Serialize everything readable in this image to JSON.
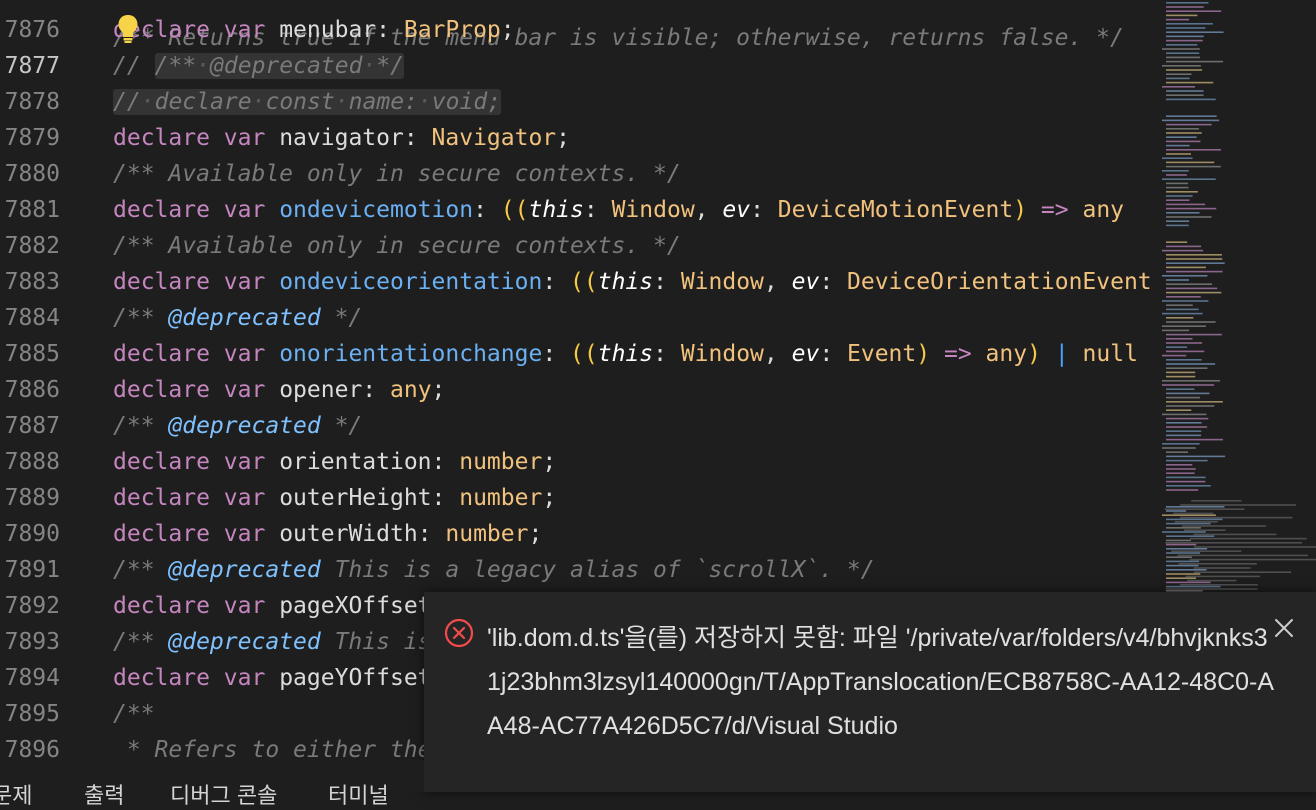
{
  "editor": {
    "top_fragment": "/** Returns true if the menu bar is visible; otherwise, returns false. */",
    "lines": [
      {
        "num": "7876",
        "tokens": [
          [
            "kw",
            "declare"
          ],
          [
            "sp",
            " "
          ],
          [
            "kw",
            "var"
          ],
          [
            "sp",
            " "
          ],
          [
            "id",
            "menubar"
          ],
          [
            "punc",
            ": "
          ],
          [
            "type",
            "BarProp"
          ],
          [
            "punc",
            ";"
          ]
        ]
      },
      {
        "num": "7877",
        "active": true,
        "tokens": [
          [
            "comment",
            "// "
          ],
          [
            "commentHL",
            "/**·@deprecated·*/"
          ]
        ]
      },
      {
        "num": "7878",
        "tokens": [
          [
            "commentHL",
            "//·declare·const·name:·void;"
          ]
        ]
      },
      {
        "num": "7879",
        "tokens": [
          [
            "kw",
            "declare"
          ],
          [
            "sp",
            " "
          ],
          [
            "kw",
            "var"
          ],
          [
            "sp",
            " "
          ],
          [
            "id",
            "navigator"
          ],
          [
            "punc",
            ": "
          ],
          [
            "type",
            "Navigator"
          ],
          [
            "punc",
            ";"
          ]
        ]
      },
      {
        "num": "7880",
        "tokens": [
          [
            "comment",
            "/** Available only in secure contexts. */"
          ]
        ]
      },
      {
        "num": "7881",
        "tokens": [
          [
            "kw",
            "declare"
          ],
          [
            "sp",
            " "
          ],
          [
            "kw",
            "var"
          ],
          [
            "sp",
            " "
          ],
          [
            "prop",
            "ondevicemotion"
          ],
          [
            "punc",
            ": "
          ],
          [
            "paren",
            "(("
          ],
          [
            "this",
            "this"
          ],
          [
            "punc",
            ": "
          ],
          [
            "type",
            "Window"
          ],
          [
            "punc",
            ", "
          ],
          [
            "this",
            "ev"
          ],
          [
            "punc",
            ": "
          ],
          [
            "type",
            "DeviceMotionEvent"
          ],
          [
            "paren",
            ")"
          ],
          [
            "sp",
            " "
          ],
          [
            "arrow",
            "=>"
          ],
          [
            "sp",
            " "
          ],
          [
            "type",
            "any"
          ]
        ]
      },
      {
        "num": "7882",
        "tokens": [
          [
            "comment",
            "/** Available only in secure contexts. */"
          ]
        ]
      },
      {
        "num": "7883",
        "tokens": [
          [
            "kw",
            "declare"
          ],
          [
            "sp",
            " "
          ],
          [
            "kw",
            "var"
          ],
          [
            "sp",
            " "
          ],
          [
            "prop",
            "ondeviceorientation"
          ],
          [
            "punc",
            ": "
          ],
          [
            "paren",
            "(("
          ],
          [
            "this",
            "this"
          ],
          [
            "punc",
            ": "
          ],
          [
            "type",
            "Window"
          ],
          [
            "punc",
            ", "
          ],
          [
            "this",
            "ev"
          ],
          [
            "punc",
            ": "
          ],
          [
            "type",
            "DeviceOrientationEvent"
          ]
        ]
      },
      {
        "num": "7884",
        "tokens": [
          [
            "comment",
            "/** "
          ],
          [
            "tag",
            "@deprecated"
          ],
          [
            "comment",
            " */"
          ]
        ]
      },
      {
        "num": "7885",
        "tokens": [
          [
            "kw",
            "declare"
          ],
          [
            "sp",
            " "
          ],
          [
            "kw",
            "var"
          ],
          [
            "sp",
            " "
          ],
          [
            "prop",
            "onorientationchange"
          ],
          [
            "punc",
            ": "
          ],
          [
            "paren",
            "(("
          ],
          [
            "this",
            "this"
          ],
          [
            "punc",
            ": "
          ],
          [
            "type",
            "Window"
          ],
          [
            "punc",
            ", "
          ],
          [
            "this",
            "ev"
          ],
          [
            "punc",
            ": "
          ],
          [
            "type",
            "Event"
          ],
          [
            "paren",
            ")"
          ],
          [
            "sp",
            " "
          ],
          [
            "arrow",
            "=>"
          ],
          [
            "sp",
            " "
          ],
          [
            "type",
            "any"
          ],
          [
            "paren",
            ")"
          ],
          [
            "sp",
            " "
          ],
          [
            "bar",
            "|"
          ],
          [
            "sp",
            " "
          ],
          [
            "type",
            "null"
          ]
        ]
      },
      {
        "num": "7886",
        "tokens": [
          [
            "kw",
            "declare"
          ],
          [
            "sp",
            " "
          ],
          [
            "kw",
            "var"
          ],
          [
            "sp",
            " "
          ],
          [
            "id",
            "opener"
          ],
          [
            "punc",
            ": "
          ],
          [
            "type",
            "any"
          ],
          [
            "punc",
            ";"
          ]
        ]
      },
      {
        "num": "7887",
        "tokens": [
          [
            "comment",
            "/** "
          ],
          [
            "tag",
            "@deprecated"
          ],
          [
            "comment",
            " */"
          ]
        ]
      },
      {
        "num": "7888",
        "tokens": [
          [
            "kw",
            "declare"
          ],
          [
            "sp",
            " "
          ],
          [
            "kw",
            "var"
          ],
          [
            "sp",
            " "
          ],
          [
            "id",
            "orientation"
          ],
          [
            "punc",
            ": "
          ],
          [
            "type",
            "number"
          ],
          [
            "punc",
            ";"
          ]
        ]
      },
      {
        "num": "7889",
        "tokens": [
          [
            "kw",
            "declare"
          ],
          [
            "sp",
            " "
          ],
          [
            "kw",
            "var"
          ],
          [
            "sp",
            " "
          ],
          [
            "id",
            "outerHeight"
          ],
          [
            "punc",
            ": "
          ],
          [
            "type",
            "number"
          ],
          [
            "punc",
            ";"
          ]
        ]
      },
      {
        "num": "7890",
        "tokens": [
          [
            "kw",
            "declare"
          ],
          [
            "sp",
            " "
          ],
          [
            "kw",
            "var"
          ],
          [
            "sp",
            " "
          ],
          [
            "id",
            "outerWidth"
          ],
          [
            "punc",
            ": "
          ],
          [
            "type",
            "number"
          ],
          [
            "punc",
            ";"
          ]
        ]
      },
      {
        "num": "7891",
        "tokens": [
          [
            "comment",
            "/** "
          ],
          [
            "tag",
            "@deprecated"
          ],
          [
            "comment",
            " This is a legacy alias of `scrollX`. */"
          ]
        ]
      },
      {
        "num": "7892",
        "tokens": [
          [
            "kw",
            "declare"
          ],
          [
            "sp",
            " "
          ],
          [
            "kw",
            "var"
          ],
          [
            "sp",
            " "
          ],
          [
            "id",
            "pageXOffset"
          ]
        ]
      },
      {
        "num": "7893",
        "tokens": [
          [
            "comment",
            "/** "
          ],
          [
            "tag",
            "@deprecated"
          ],
          [
            "comment",
            " This is"
          ]
        ]
      },
      {
        "num": "7894",
        "tokens": [
          [
            "kw",
            "declare"
          ],
          [
            "sp",
            " "
          ],
          [
            "kw",
            "var"
          ],
          [
            "sp",
            " "
          ],
          [
            "id",
            "pageYOffset"
          ]
        ]
      },
      {
        "num": "7895",
        "tokens": [
          [
            "comment",
            "/**"
          ]
        ]
      },
      {
        "num": "7896",
        "tokens": [
          [
            "comment",
            " * Refers to either the"
          ]
        ]
      }
    ]
  },
  "notification": {
    "icon": "error-circle-icon",
    "message": "'lib.dom.d.ts'을(를) 저장하지 못함: 파일 '/private/var/folders/v4/bhvjknks31j23bhm3lzsyl140000gn/T/AppTranslocation/ECB8758C-AA12-48C0-AA48-AC77A426D5C7/d/Visual Studio",
    "close_icon": "close-icon"
  },
  "panel_tabs": [
    "문제",
    "출력",
    "디버그 콘솔",
    "터미널"
  ],
  "colors": {
    "background": "#1e1e1e",
    "keyword": "#c586c0",
    "type": "#f1c27d",
    "property": "#6ab0f3",
    "comment": "#7a7a7a",
    "notification_bg": "#252526",
    "error": "#f14c4c"
  }
}
